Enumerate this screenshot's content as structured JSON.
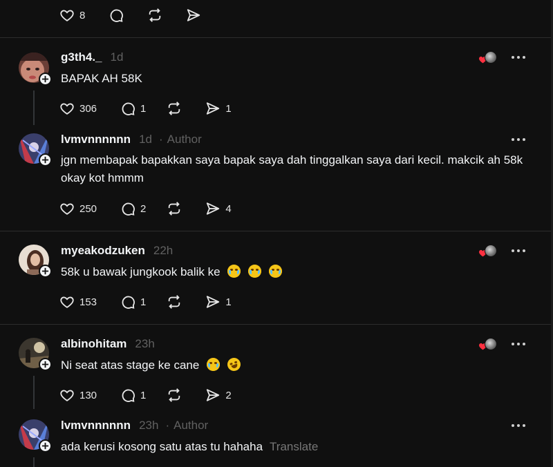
{
  "top_actions": {
    "likes": "8"
  },
  "comments": [
    {
      "username": "g3th4._",
      "time": "1d",
      "text": "BAPAK AH 58K",
      "likes": "306",
      "replies": "1",
      "reposts": "",
      "shares": "1",
      "liked_by_author": true,
      "is_author": false,
      "author_label": ""
    },
    {
      "username": "lvmvnnnnnn",
      "time": "1d",
      "text": "jgn membapak bapakkan saya bapak saya dah tinggalkan saya dari kecil. makcik ah 58k okay kot hmmm",
      "likes": "250",
      "replies": "2",
      "reposts": "",
      "shares": "4",
      "liked_by_author": false,
      "is_author": true,
      "author_label": "Author"
    },
    {
      "username": "myeakodzuken",
      "time": "22h",
      "text": "58k u bawak jungkook balik ke",
      "emojis": [
        "loudly-crying-face",
        "loudly-crying-face",
        "loudly-crying-face"
      ],
      "likes": "153",
      "replies": "1",
      "reposts": "",
      "shares": "1",
      "liked_by_author": true
    },
    {
      "username": "albinohitam",
      "time": "23h",
      "text": "Ni seat atas stage ke cane",
      "emojis": [
        "loudly-crying-face",
        "rolling-on-floor-laughing"
      ],
      "likes": "130",
      "replies": "1",
      "reposts": "",
      "shares": "2",
      "liked_by_author": true
    },
    {
      "username": "lvmvnnnnnn",
      "time": "23h",
      "text": "ada kerusi kosong satu atas tu hahaha",
      "translate": "Translate",
      "author_label": "Author",
      "is_author": true
    }
  ],
  "colors": {
    "background": "#101010",
    "text": "#f3f5f7",
    "muted": "#616161",
    "divider": "#2d2d2d",
    "heart_red": "#ff3040"
  }
}
